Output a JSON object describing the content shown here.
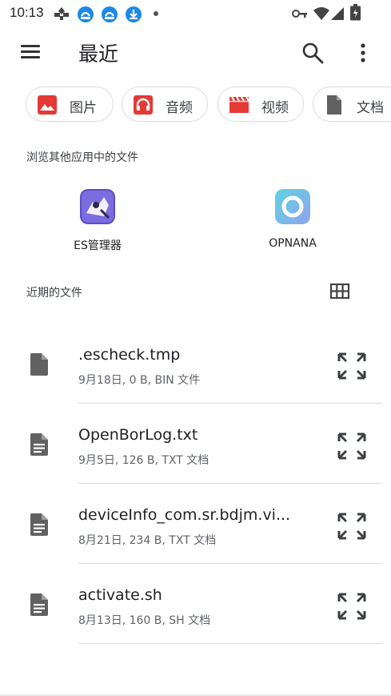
{
  "status_bar": {
    "time": "10:13",
    "icons": [
      "usb-icon",
      "sync-icon",
      "sync-icon",
      "download-icon",
      "dot-icon",
      "key-icon",
      "wifi-icon",
      "signal-icon",
      "battery-icon"
    ]
  },
  "app_bar": {
    "title": "最近",
    "icons": [
      "menu-icon",
      "search-icon",
      "more-vert-icon"
    ]
  },
  "chips": [
    {
      "label": "图片",
      "icon": "image-icon",
      "color": "#e53935"
    },
    {
      "label": "音频",
      "icon": "headphones-icon",
      "color": "#e53935"
    },
    {
      "label": "视频",
      "icon": "movie-icon",
      "color": "#e53935"
    },
    {
      "label": "文档",
      "icon": "document-icon",
      "color": "#616161"
    }
  ],
  "other_apps": {
    "heading": "浏览其他应用中的文件",
    "apps": [
      {
        "name": "ES管理器",
        "icon": "es-app-icon"
      },
      {
        "name": "OPNANA",
        "icon": "opnana-app-icon"
      }
    ]
  },
  "recent_files": {
    "heading": "近期的文件",
    "view_toggle_icon": "grid-view-icon",
    "files": [
      {
        "name": ".escheck.tmp",
        "meta": "9月18日, 0 B, BIN 文件",
        "icon": "file-icon"
      },
      {
        "name": "OpenBorLog.txt",
        "meta": "9月5日, 126 B, TXT 文档",
        "icon": "text-file-icon"
      },
      {
        "name": "deviceInfo_com.sr.bdjm.vi...",
        "meta": "8月21日, 234 B, TXT 文档",
        "icon": "text-file-icon"
      },
      {
        "name": "activate.sh",
        "meta": "8月13日, 160 B, SH 文档",
        "icon": "text-file-icon"
      }
    ]
  },
  "colors": {
    "accent": "#1a73e8",
    "text_primary": "#202124",
    "text_secondary": "#5f6368",
    "divider": "#dadce0",
    "chip_red": "#e53935",
    "icon_grey": "#616161"
  }
}
